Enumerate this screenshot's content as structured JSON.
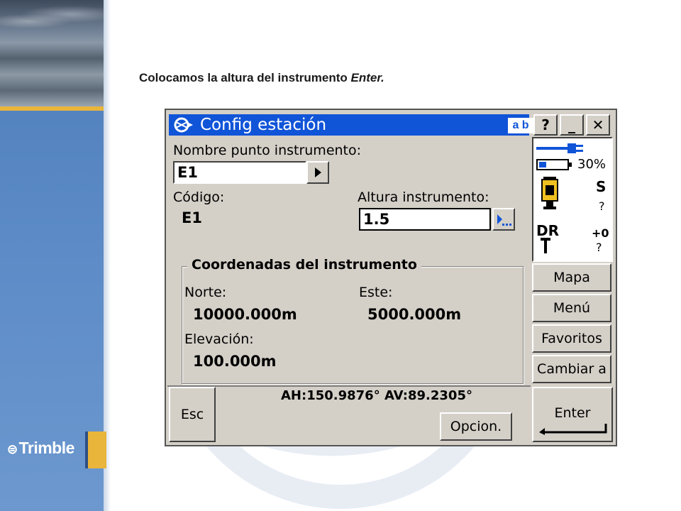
{
  "caption": {
    "text": "Colocamos la altura del instrumento ",
    "emphasis": "Enter."
  },
  "brand": {
    "logo_text": "Trimble",
    "accent_color": "#e9b53a",
    "band_color": "#4d7cb9"
  },
  "window": {
    "title": "Config estación",
    "input_mode": "a b",
    "help_label": "?",
    "minimize_label": "_",
    "close_label": "✕",
    "title_bar_color": "#1054d8"
  },
  "form": {
    "point_name_label": "Nombre punto instrumento:",
    "point_name_value": "E1",
    "code_label": "Código:",
    "code_value": "E1",
    "height_label": "Altura instrumento:",
    "height_value": "1.5",
    "coords_title": "Coordenadas del instrumento",
    "north_label": "Norte:",
    "north_value": "10000.000m",
    "east_label": "Este:",
    "east_value": "5000.000m",
    "elev_label": "Elevación:",
    "elev_value": "100.000m"
  },
  "status": {
    "battery_percent": "30%",
    "instrument_flag": "S",
    "instrument_q": "?",
    "dr_label": "DR",
    "offset_label": "+0",
    "offset_q": "?"
  },
  "side_buttons": [
    "Mapa",
    "Menú",
    "Favoritos",
    "Cambiar a"
  ],
  "bottom": {
    "esc_label": "Esc",
    "angles": "AH:150.9876°  AV:89.2305°",
    "options_label": "Opcion.",
    "enter_label": "Enter"
  }
}
